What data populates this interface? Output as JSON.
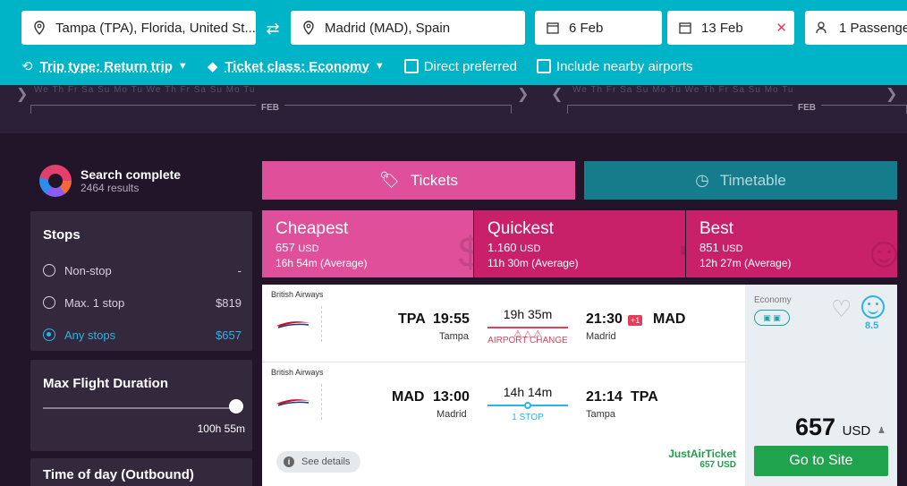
{
  "search": {
    "from": "Tampa (TPA), Florida, United St...",
    "to": "Madrid (MAD), Spain",
    "depart_date": "6 Feb",
    "return_date": "13 Feb",
    "passengers": "1 Passenger"
  },
  "filters": {
    "trip_type": "Trip type: Return trip",
    "ticket_class": "Ticket class: Economy",
    "direct": "Direct preferred",
    "nearby": "Include nearby airports"
  },
  "calendar": {
    "days_left": "We  Th  Fr  Sa  Su  Mo  Tu  We  Th  Fr  Sa  Su  Mo  Tu",
    "days_right": "We  Th  Fr  Sa  Su  Mo  Tu  We  Th  Fr  Sa  Su  Mo  Tu",
    "month_left": "FEB",
    "month_right": "FEB"
  },
  "status": {
    "title": "Search complete",
    "results": "2464 results"
  },
  "sidebar": {
    "stops_title": "Stops",
    "stops": [
      {
        "label": "Non-stop",
        "price": "-"
      },
      {
        "label": "Max. 1 stop",
        "price": "$819"
      },
      {
        "label": "Any stops",
        "price": "$657"
      }
    ],
    "duration_title": "Max Flight Duration",
    "duration_value": "100h 55m",
    "time_title": "Time of day (Outbound)"
  },
  "tabs": {
    "tickets": "Tickets",
    "timetable": "Timetable"
  },
  "sort": [
    {
      "name": "Cheapest",
      "price": "657",
      "currency": "USD",
      "avg": "16h 54m (Average)"
    },
    {
      "name": "Quickest",
      "price": "1.160",
      "currency": "USD",
      "avg": "11h 30m (Average)"
    },
    {
      "name": "Best",
      "price": "851",
      "currency": "USD",
      "avg": "12h 27m (Average)"
    }
  ],
  "result": {
    "outbound": {
      "airline": "British Airways",
      "from_code": "TPA",
      "dep_time": "19:55",
      "from_city": "Tampa",
      "duration": "19h 35m",
      "note": "AIRPORT CHANGE",
      "arr_time": "21:30",
      "plus_day": "+1",
      "to_code": "MAD",
      "to_city": "Madrid"
    },
    "inbound": {
      "airline": "British Airways",
      "from_code": "MAD",
      "dep_time": "13:00",
      "from_city": "Madrid",
      "duration": "14h 14m",
      "note": "1 STOP",
      "arr_time": "21:14",
      "to_code": "TPA",
      "to_city": "Tampa"
    },
    "see_details": "See details",
    "provider": "JustAirTicket",
    "provider_price": "657 USD",
    "class": "Economy",
    "score": "8.5",
    "price": "657",
    "currency": "USD",
    "cta": "Go to Site"
  },
  "colors": {
    "topbar": "#00b4c8",
    "tickets_tab": "#e0509a",
    "timetable_tab": "#157c8c",
    "sort_active": "#e0509a",
    "sort_inactive": "#c8216a",
    "cta": "#1fa34d",
    "accent_blue": "#2bb4e6"
  }
}
